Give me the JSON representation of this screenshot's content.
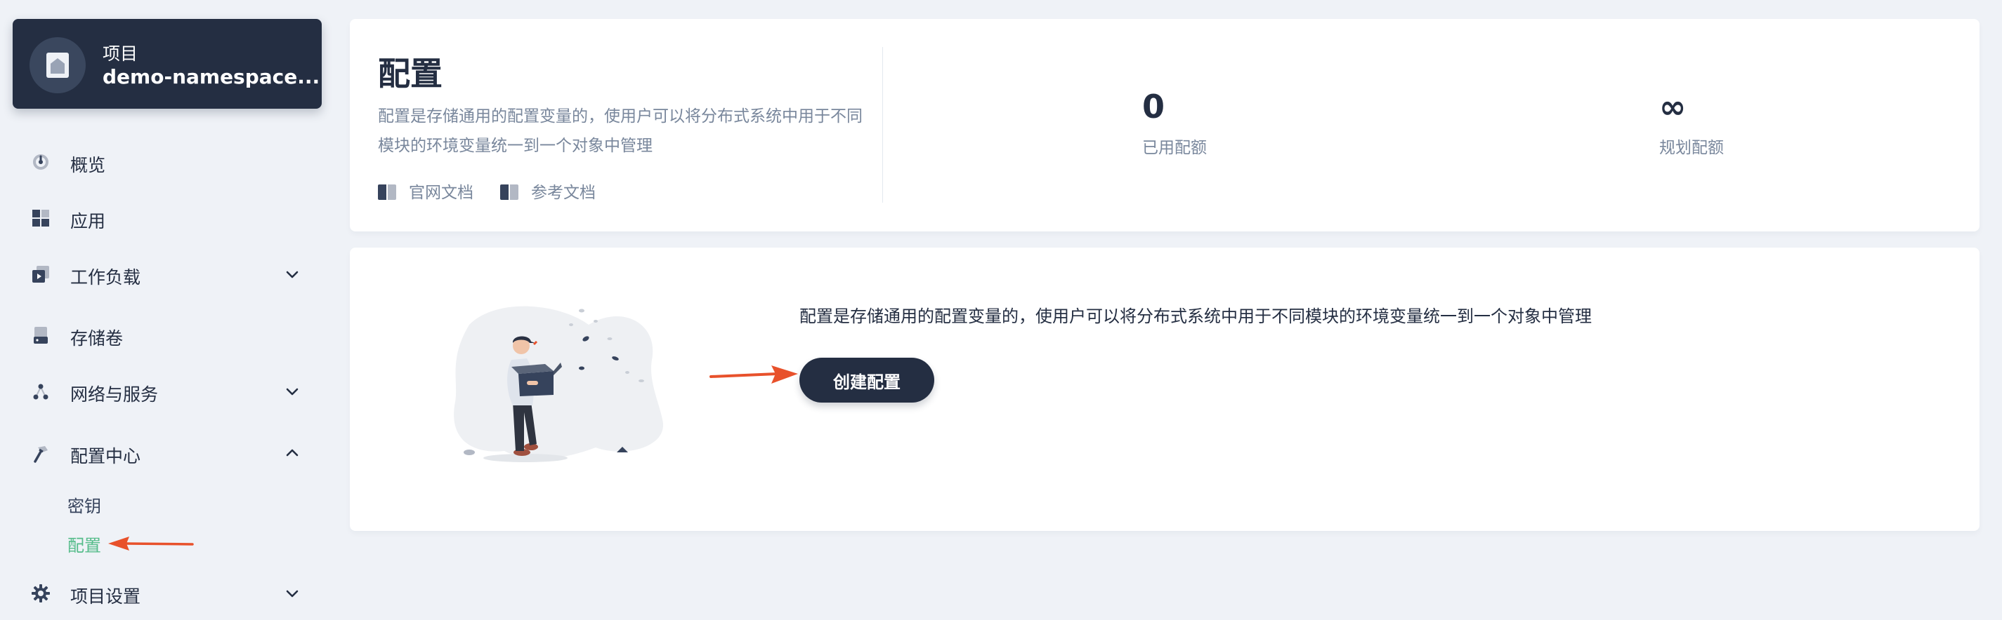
{
  "project": {
    "type_label": "项目",
    "name": "demo-namespace..."
  },
  "sidebar": {
    "items": [
      {
        "label": "概览",
        "icon": "dashboard-icon"
      },
      {
        "label": "应用",
        "icon": "apps-icon"
      },
      {
        "label": "工作负载",
        "icon": "workload-icon"
      },
      {
        "label": "存储卷",
        "icon": "storage-icon"
      },
      {
        "label": "网络与服务",
        "icon": "network-icon"
      },
      {
        "label": "配置中心",
        "icon": "hammer-icon"
      },
      {
        "label": "项目设置",
        "icon": "gear-icon"
      }
    ],
    "config_center_sub": [
      {
        "label": "密钥"
      },
      {
        "label": "配置",
        "active": true
      }
    ]
  },
  "header": {
    "title": "配置",
    "description": "配置是存储通用的配置变量的，使用户可以将分布式系统中用于不同模块的环境变量统一到一个对象中管理",
    "links": [
      {
        "label": "官网文档"
      },
      {
        "label": "参考文档"
      }
    ],
    "stats": [
      {
        "value": "0",
        "label": "已用配额"
      },
      {
        "value": "∞",
        "label": "规划配额"
      }
    ]
  },
  "empty_state": {
    "description": "配置是存储通用的配置变量的，使用户可以将分布式系统中用于不同模块的环境变量统一到一个对象中管理",
    "create_button": "创建配置"
  },
  "colors": {
    "sidebar_dark": "#242e42",
    "active_green": "#55bc8a",
    "annotation_arrow": "#e8512b",
    "background": "#eff2f7"
  }
}
